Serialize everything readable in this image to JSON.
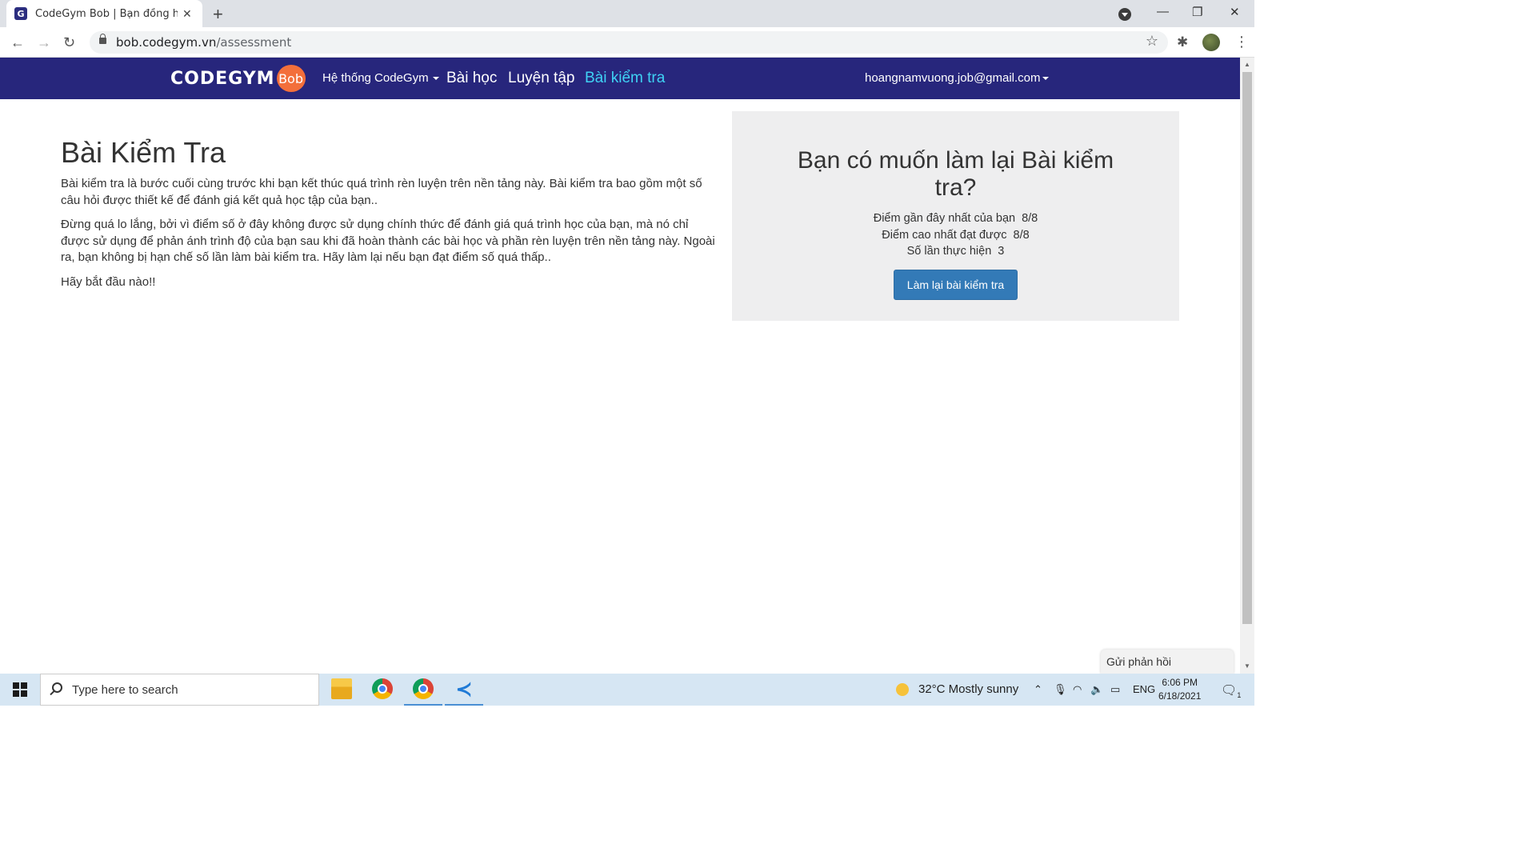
{
  "browser": {
    "tab_title": "CodeGym Bob | Bạn đồng hành c",
    "url_domain": "bob.codegym.vn",
    "url_path": "/assessment"
  },
  "nav": {
    "logo_text": "CODEGYM",
    "logo_badge": "Bob",
    "system": "Hệ thống CodeGym",
    "lessons": "Bài học",
    "practice": "Luyện tập",
    "test": "Bài kiểm tra",
    "user": "hoangnamvuong.job@gmail.com"
  },
  "main": {
    "title": "Bài Kiểm Tra",
    "p1": "Bài kiểm tra là bước cuối cùng trước khi bạn kết thúc quá trình rèn luyện trên nền tảng này. Bài kiểm tra bao gồm một số câu hỏi được thiết kế để đánh giá kết quả học tập của bạn..",
    "p2": "Đừng quá lo lắng, bởi vì điểm số ở đây không được sử dụng chính thức để đánh giá quá trình học của bạn, mà nó chỉ được sử dụng để phản ánh trình độ của bạn sau khi đã hoàn thành các bài học và phần rèn luyện trên nền tảng này. Ngoài ra, bạn không bị hạn chế số lần làm bài kiểm tra. Hãy làm lại nếu bạn đạt điểm số quá thấp..",
    "p3": "Hãy bắt đầu nào!!"
  },
  "retry": {
    "question": "Bạn có muốn làm lại Bài kiểm tra?",
    "recent_label": "Điểm gần đây nhất của bạn",
    "recent_value": "8/8",
    "best_label": "Điểm cao nhất đạt được",
    "best_value": "8/8",
    "attempts_label": "Số lần thực hiện",
    "attempts_value": "3",
    "button": "Làm lại bài kiểm tra"
  },
  "feedback": "Gửi phản hồi",
  "taskbar": {
    "search_placeholder": "Type here to search",
    "weather": "32°C  Mostly sunny",
    "lang": "ENG",
    "time": "6:06 PM",
    "date": "6/18/2021",
    "notif_count": "1"
  },
  "colors": {
    "nav_bg": "#27267c",
    "nav_active": "#3fd2f4",
    "button_bg": "#337ab7",
    "panel_bg": "#eeeeef",
    "logo_badge": "#f36f3b"
  }
}
